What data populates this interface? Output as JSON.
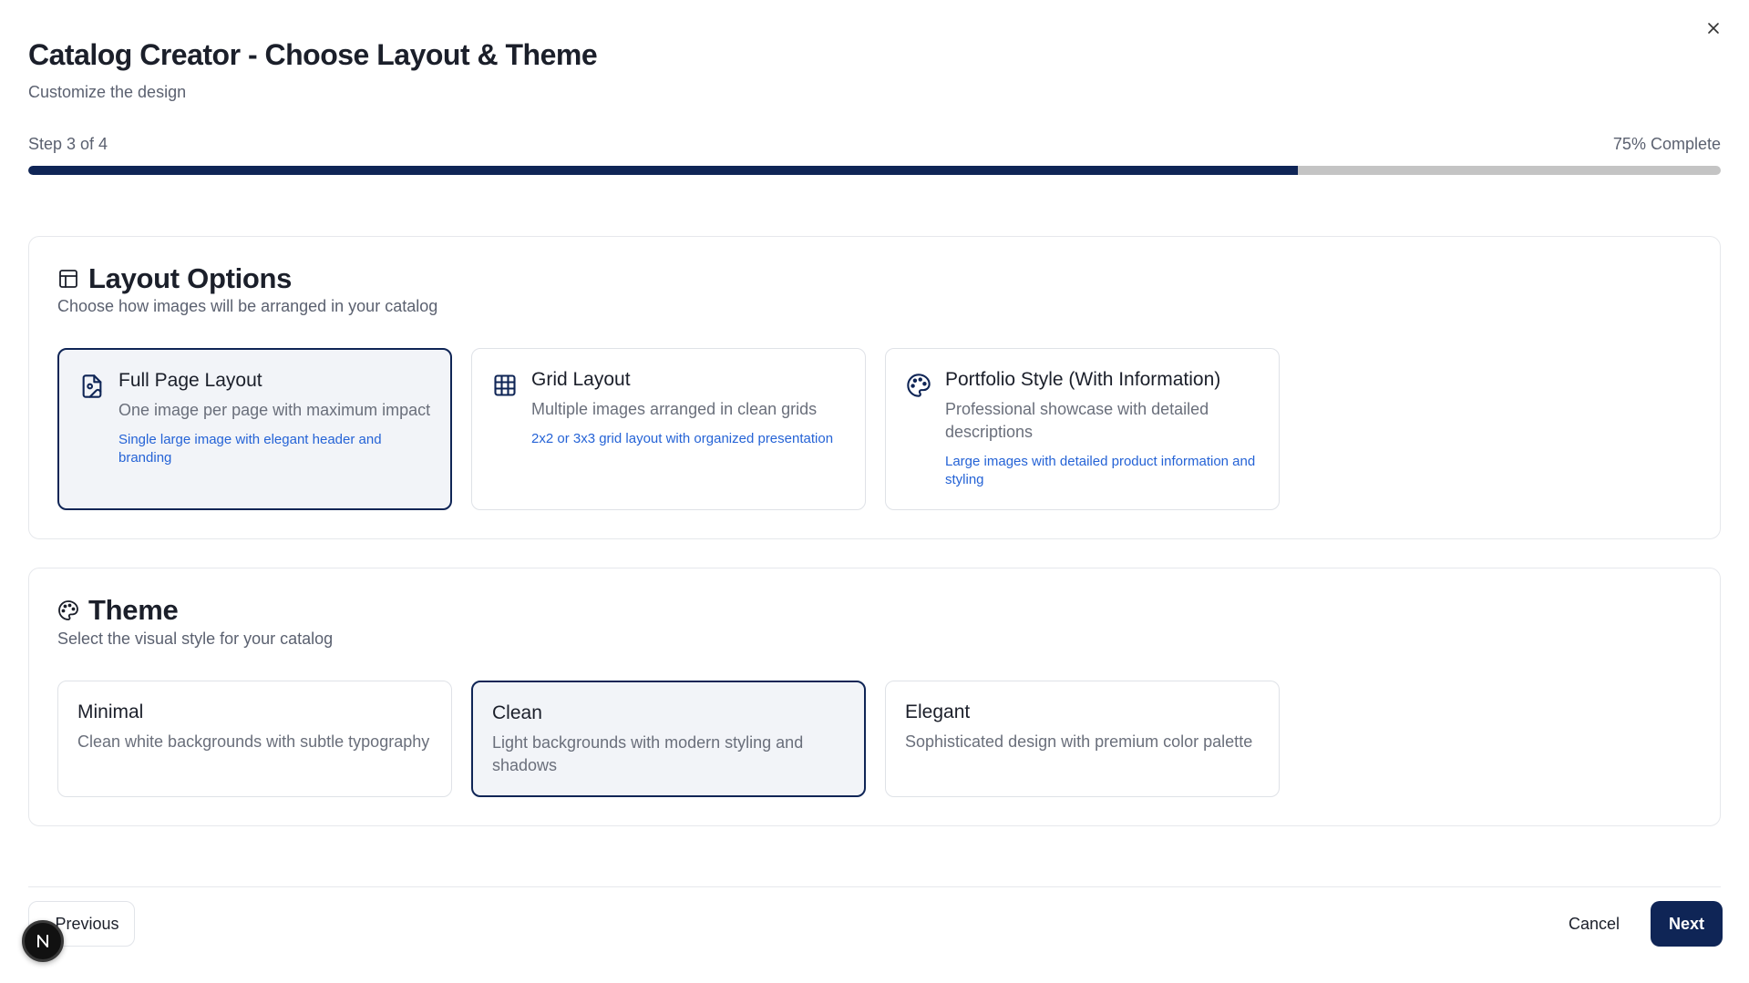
{
  "dialog": {
    "title": "Catalog Creator - Choose Layout & Theme",
    "subtitle": "Customize the design",
    "close_icon": "close-icon"
  },
  "progress": {
    "step_label": "Step 3 of 4",
    "percent_label": "75% Complete",
    "value": 0.75,
    "fill_color": "#0f2556",
    "track_color": "#c4c4c4"
  },
  "layout_section": {
    "icon": "layout-icon",
    "title": "Layout Options",
    "description": "Choose how images will be arranged in your catalog",
    "options": [
      {
        "icon": "image-file-icon",
        "title": "Full Page Layout",
        "description": "One image per page with maximum impact",
        "note": "Single large image with elegant header and branding",
        "selected": true
      },
      {
        "icon": "grid-icon",
        "title": "Grid Layout",
        "description": "Multiple images arranged in clean grids",
        "note": "2x2 or 3x3 grid layout with organized presentation",
        "selected": false
      },
      {
        "icon": "palette-icon",
        "title": "Portfolio Style (With Information)",
        "description": "Professional showcase with detailed descriptions",
        "note": "Large images with detailed product information and styling",
        "selected": false
      }
    ]
  },
  "theme_section": {
    "icon": "palette-icon",
    "title": "Theme",
    "description": "Select the visual style for your catalog",
    "options": [
      {
        "title": "Minimal",
        "description": "Clean white backgrounds with subtle typography",
        "selected": false
      },
      {
        "title": "Clean",
        "description": "Light backgrounds with modern styling and shadows",
        "selected": true
      },
      {
        "title": "Elegant",
        "description": "Sophisticated design with premium color palette",
        "selected": false
      }
    ]
  },
  "footer": {
    "previous_label": "Previous",
    "cancel_label": "Cancel",
    "next_label": "Next"
  },
  "overlay_badge": {
    "letter": "N"
  },
  "colors": {
    "primary": "#0f2556",
    "link_blue": "#2563d6",
    "selected_bg": "#f2f4f8"
  }
}
